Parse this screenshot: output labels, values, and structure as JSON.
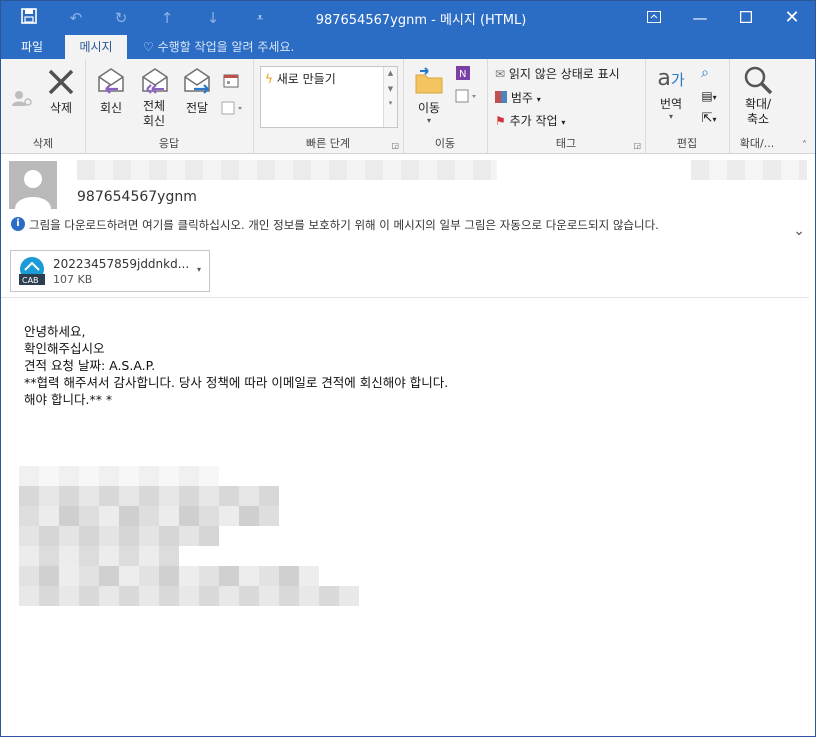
{
  "window": {
    "title": "987654567ygnm - 메시지 (HTML)",
    "controls": [
      "restore-ribbon",
      "minimize",
      "maximize",
      "close"
    ]
  },
  "tabs": {
    "file": "파일",
    "message": "메시지",
    "tell_me": "수행할 작업을 알려 주세요."
  },
  "ribbon": {
    "delete_group": {
      "label": "삭제",
      "delete": "삭제"
    },
    "respond_group": {
      "label": "응답",
      "reply": "회신",
      "reply_all_line1": "전체",
      "reply_all_line2": "회신",
      "forward": "전달"
    },
    "quick_steps_group": {
      "label": "빠른 단계",
      "new": "새로 만들기"
    },
    "move_group": {
      "label": "이동",
      "move": "이동"
    },
    "tags_group": {
      "label": "태그",
      "mark_unread": "읽지 않은 상태로 표시",
      "categorize": "범주",
      "follow_up": "추가 작업"
    },
    "editing_group": {
      "label": "편집",
      "translate": "번역"
    },
    "zoom_group": {
      "label": "확대/...",
      "zoom_line1": "확대/",
      "zoom_line2": "축소"
    }
  },
  "header": {
    "sender": "987654567ygnm",
    "info_bar": "그림을 다운로드하려면 여기를 클릭하십시오. 개인 정보를 보호하기 위해 이 메시지의 일부 그림은 자동으로 다운로드되지 않습니다."
  },
  "attachment": {
    "name": "20223457859jddnkd...",
    "size": "107 KB",
    "badge": "CAB"
  },
  "body": {
    "lines": [
      "안녕하세요,",
      "",
      "확인해주십시오",
      "견적 요청 날짜: A.S.A.P.",
      "",
      "**협력 해주셔서 감사합니다. 당사 정책에 따라 이메일로 견적에 회신해야 합니다.",
      "해야 합니다.** *"
    ]
  },
  "colors": {
    "titlebar": "#2b6cc4",
    "ribbon_bg": "#f3f3f3",
    "accent_purple": "#8a5fc7",
    "accent_blue": "#2b79c9"
  }
}
